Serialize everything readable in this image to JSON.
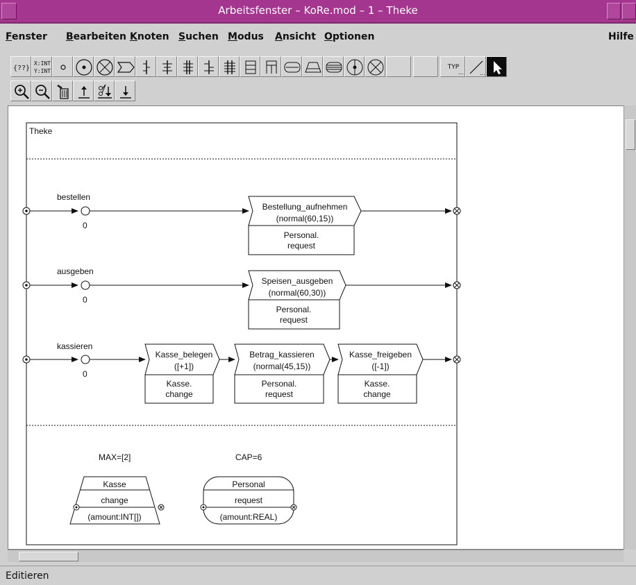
{
  "window": {
    "title": "Arbeitsfenster – KoRe.mod – 1 – Theke"
  },
  "menubar": {
    "items": [
      {
        "label": "Fenster",
        "accel": "F"
      },
      {
        "label": "Bearbeiten",
        "accel": "B"
      },
      {
        "label": "Knoten",
        "accel": "K"
      },
      {
        "label": "Suchen",
        "accel": "S"
      },
      {
        "label": "Modus",
        "accel": "M"
      },
      {
        "label": "Ansicht",
        "accel": "A"
      },
      {
        "label": "Optionen",
        "accel": "O"
      }
    ],
    "help": "Hilfe"
  },
  "toolbar": {
    "xy_label_top": "X:INT",
    "xy_label_bottom": "Y:INT",
    "typ_label": "TYP",
    "brace_label": "{??}"
  },
  "diagram": {
    "title": "Theke",
    "rows": [
      {
        "place": "bestellen",
        "token": "0",
        "activities": [
          {
            "name": "Bestellung_aufnehmen",
            "time": "(normal(60,15))",
            "resource": "Personal.",
            "action": "request"
          }
        ]
      },
      {
        "place": "ausgeben",
        "token": "0",
        "activities": [
          {
            "name": "Speisen_ausgeben",
            "time": "(normal(60,30))",
            "resource": "Personal.",
            "action": "request"
          }
        ]
      },
      {
        "place": "kassieren",
        "token": "0",
        "activities": [
          {
            "name": "Kasse_belegen",
            "time": "([+1])",
            "resource": "Kasse.",
            "action": "change"
          },
          {
            "name": "Betrag_kassieren",
            "time": "(normal(45,15))",
            "resource": "Personal.",
            "action": "request"
          },
          {
            "name": "Kasse_freigeben",
            "time": "([-1])",
            "resource": "Kasse.",
            "action": "change"
          }
        ]
      }
    ],
    "resources": [
      {
        "limit": "MAX=[2]",
        "name": "Kasse",
        "method": "change",
        "param": "(amount:INT[])"
      },
      {
        "limit": "CAP=6",
        "name": "Personal",
        "method": "request",
        "param": "(amount:REAL)"
      }
    ]
  },
  "status": {
    "mode": "Editieren"
  },
  "colors": {
    "titlebar": "#a5368f",
    "selected_tool": "#0d0d0d"
  }
}
